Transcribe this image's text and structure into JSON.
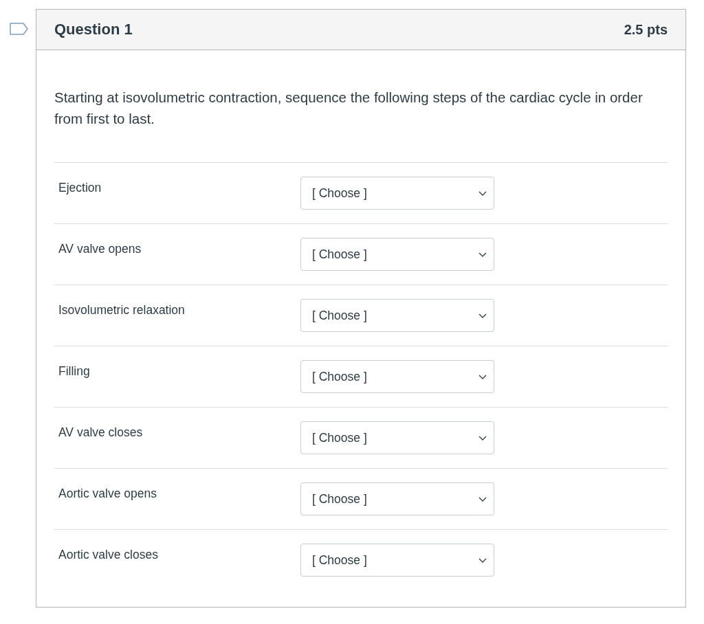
{
  "question": {
    "flagged": false,
    "title": "Question 1",
    "points": "2.5 pts",
    "prompt": "Starting at isovolumetric contraction, sequence the following steps of the cardiac cycle in order from first to last.",
    "matches": [
      {
        "label": "Ejection",
        "selection": "[ Choose ]"
      },
      {
        "label": "AV valve opens",
        "selection": "[ Choose ]"
      },
      {
        "label": "Isovolumetric relaxation",
        "selection": "[ Choose ]"
      },
      {
        "label": "Filling",
        "selection": "[ Choose ]"
      },
      {
        "label": "AV valve closes",
        "selection": "[ Choose ]"
      },
      {
        "label": "Aortic valve opens",
        "selection": "[ Choose ]"
      },
      {
        "label": "Aortic valve closes",
        "selection": "[ Choose ]"
      }
    ]
  }
}
